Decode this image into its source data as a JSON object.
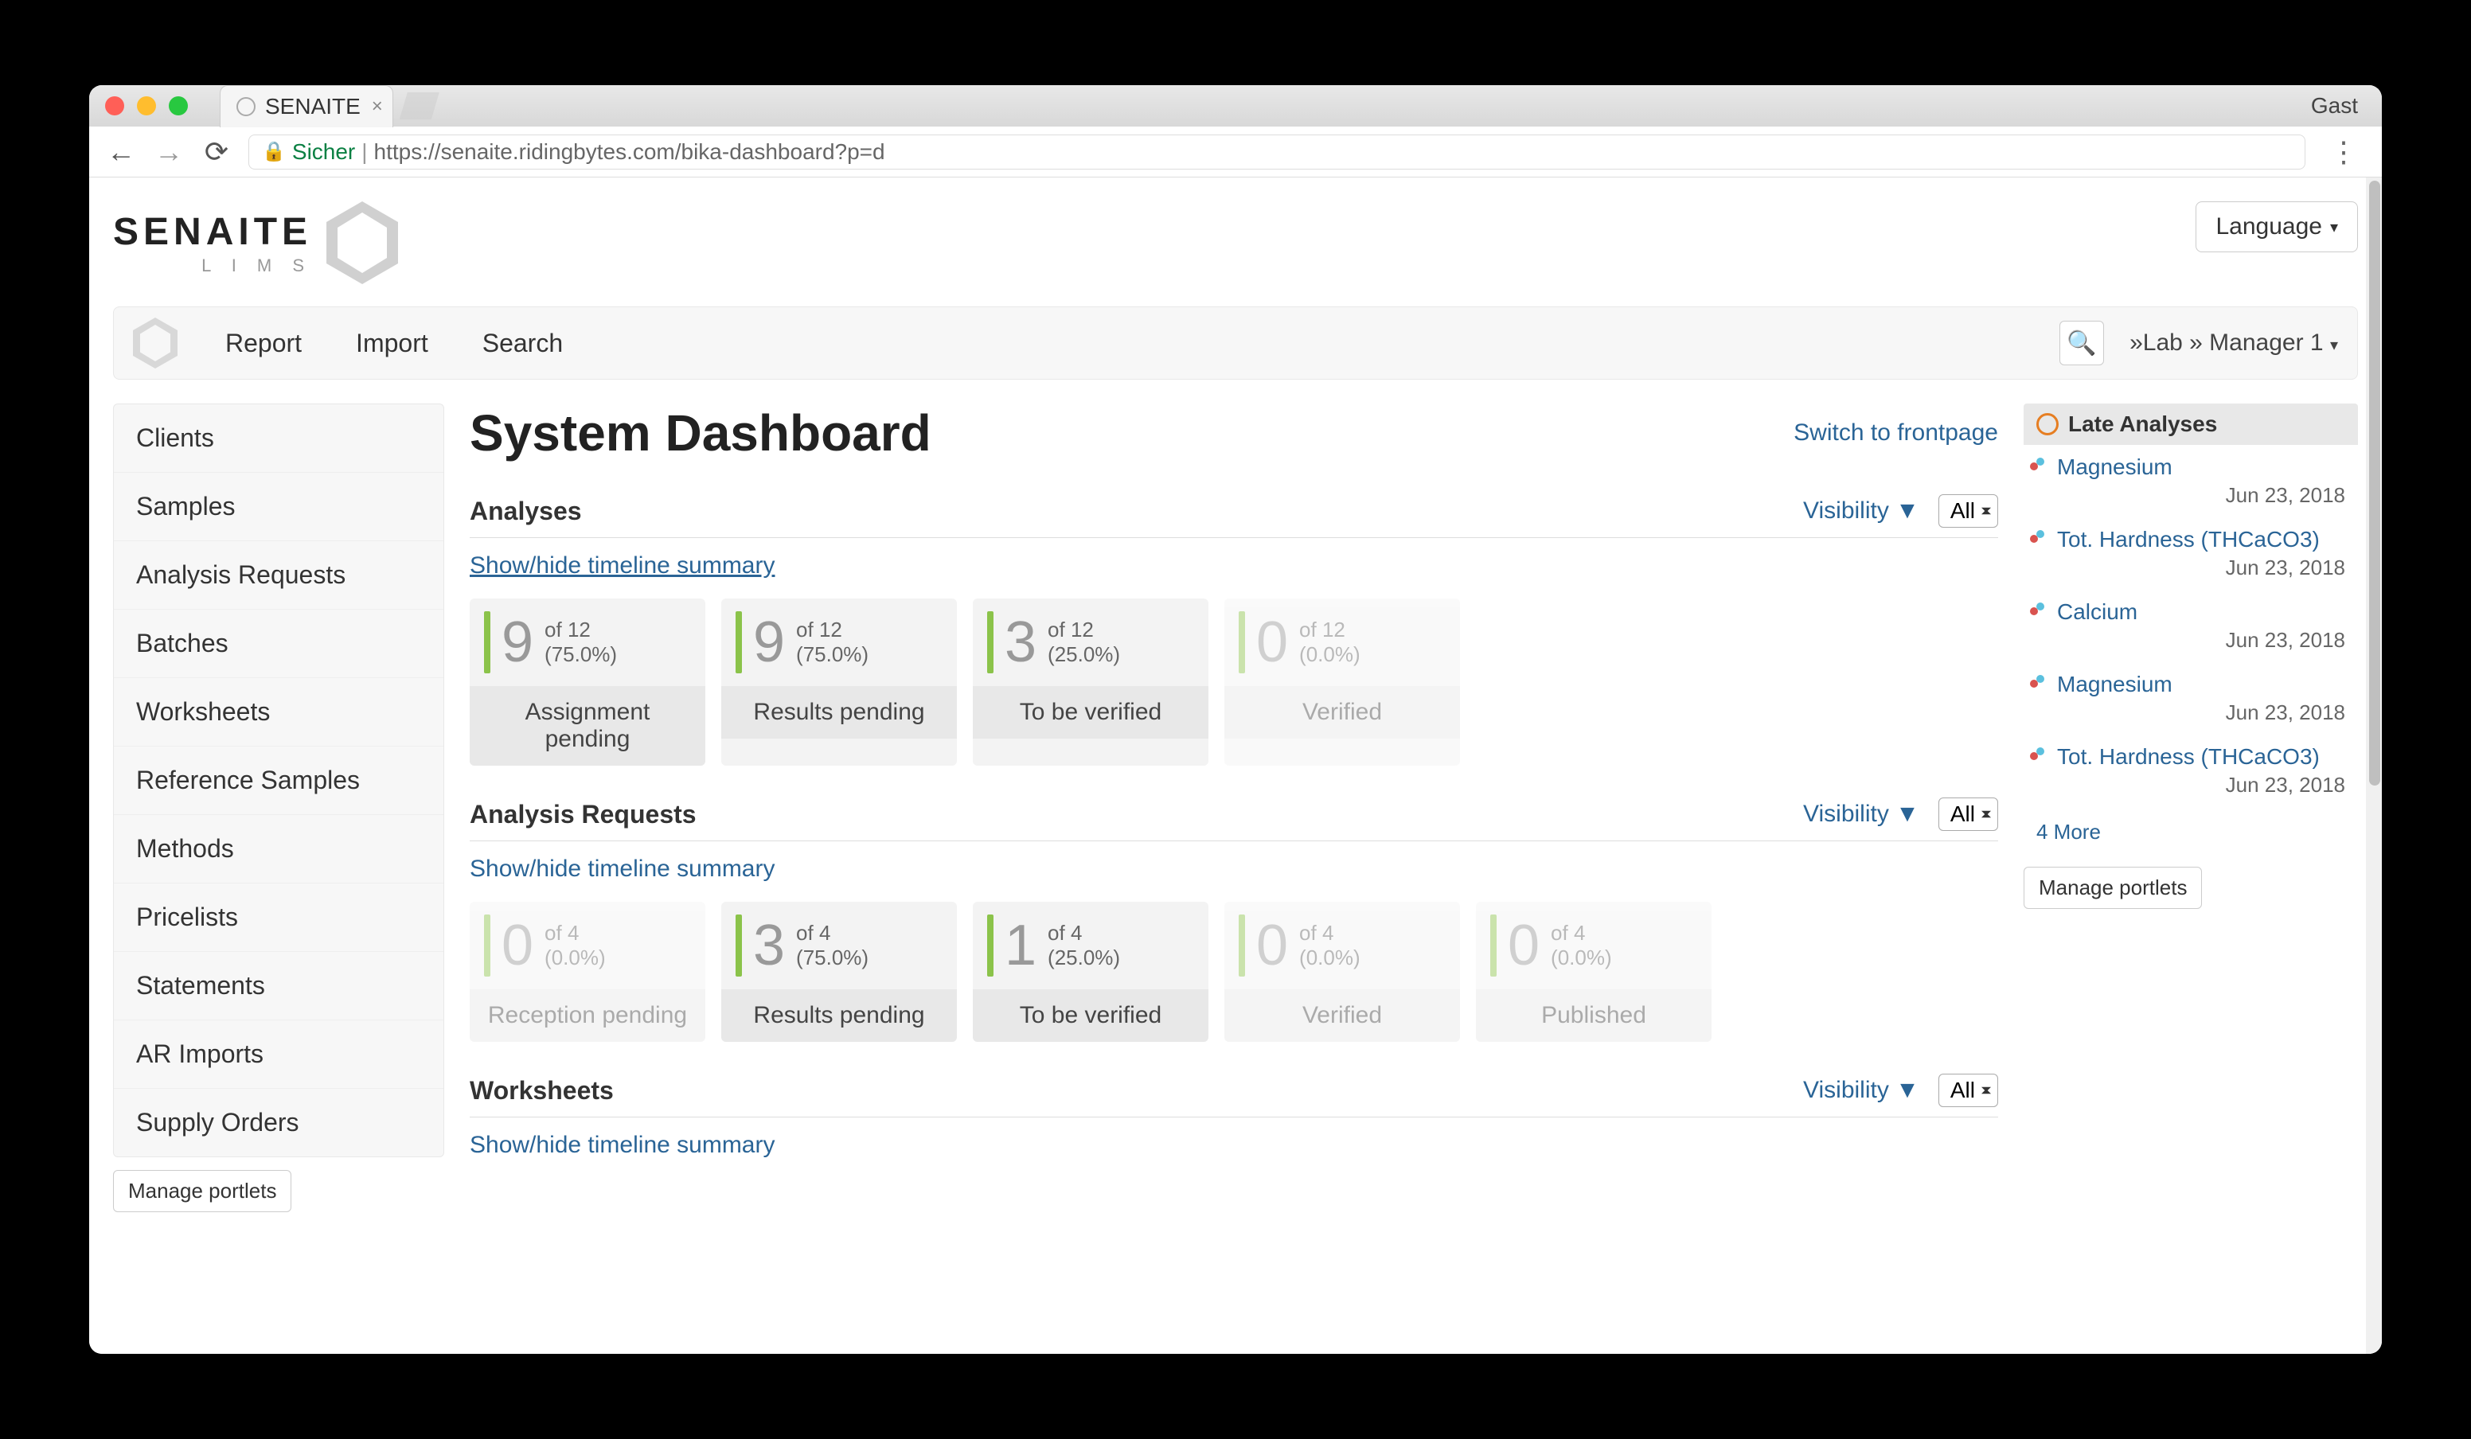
{
  "browser": {
    "tab_title": "SENAITE",
    "guest": "Gast",
    "secure_label": "Sicher",
    "url_display": "https://senaite.ridingbytes.com/bika-dashboard?p=d"
  },
  "header": {
    "logo_text": "SENAITE",
    "logo_sub": "L I M S",
    "language_label": "Language"
  },
  "navbar": {
    "items": [
      {
        "label": "Report"
      },
      {
        "label": "Import"
      },
      {
        "label": "Search"
      }
    ],
    "user": "»Lab » Manager 1"
  },
  "sidebar": {
    "items": [
      {
        "label": "Clients"
      },
      {
        "label": "Samples"
      },
      {
        "label": "Analysis Requests"
      },
      {
        "label": "Batches"
      },
      {
        "label": "Worksheets"
      },
      {
        "label": "Reference Samples"
      },
      {
        "label": "Methods"
      },
      {
        "label": "Pricelists"
      },
      {
        "label": "Statements"
      },
      {
        "label": "AR Imports"
      },
      {
        "label": "Supply Orders"
      }
    ],
    "manage_label": "Manage portlets"
  },
  "main": {
    "title": "System Dashboard",
    "switch_link": "Switch to frontpage",
    "visibility_label": "Visibility ▼",
    "filter_value": "All",
    "timeline_link": "Show/hide timeline summary",
    "sections": [
      {
        "title": "Analyses",
        "cards": [
          {
            "num": "9",
            "of": "of 12",
            "pct": "(75.0%)",
            "label": "Assignment pending",
            "dim": false
          },
          {
            "num": "9",
            "of": "of 12",
            "pct": "(75.0%)",
            "label": "Results pending",
            "dim": false
          },
          {
            "num": "3",
            "of": "of 12",
            "pct": "(25.0%)",
            "label": "To be verified",
            "dim": false
          },
          {
            "num": "0",
            "of": "of 12",
            "pct": "(0.0%)",
            "label": "Verified",
            "dim": true
          }
        ]
      },
      {
        "title": "Analysis Requests",
        "cards": [
          {
            "num": "0",
            "of": "of 4",
            "pct": "(0.0%)",
            "label": "Reception pending",
            "dim": true
          },
          {
            "num": "3",
            "of": "of 4",
            "pct": "(75.0%)",
            "label": "Results pending",
            "dim": false
          },
          {
            "num": "1",
            "of": "of 4",
            "pct": "(25.0%)",
            "label": "To be verified",
            "dim": false
          },
          {
            "num": "0",
            "of": "of 4",
            "pct": "(0.0%)",
            "label": "Verified",
            "dim": true
          },
          {
            "num": "0",
            "of": "of 4",
            "pct": "(0.0%)",
            "label": "Published",
            "dim": true
          }
        ]
      },
      {
        "title": "Worksheets",
        "cards": []
      }
    ]
  },
  "right": {
    "portlet_title": "Late Analyses",
    "items": [
      {
        "name": "Magnesium",
        "date": "Jun 23, 2018"
      },
      {
        "name": "Tot. Hardness (THCaCO3)",
        "date": "Jun 23, 2018"
      },
      {
        "name": "Calcium",
        "date": "Jun 23, 2018"
      },
      {
        "name": "Magnesium",
        "date": "Jun 23, 2018"
      },
      {
        "name": "Tot. Hardness (THCaCO3)",
        "date": "Jun 23, 2018"
      }
    ],
    "more": "4 More",
    "manage_label": "Manage portlets"
  }
}
